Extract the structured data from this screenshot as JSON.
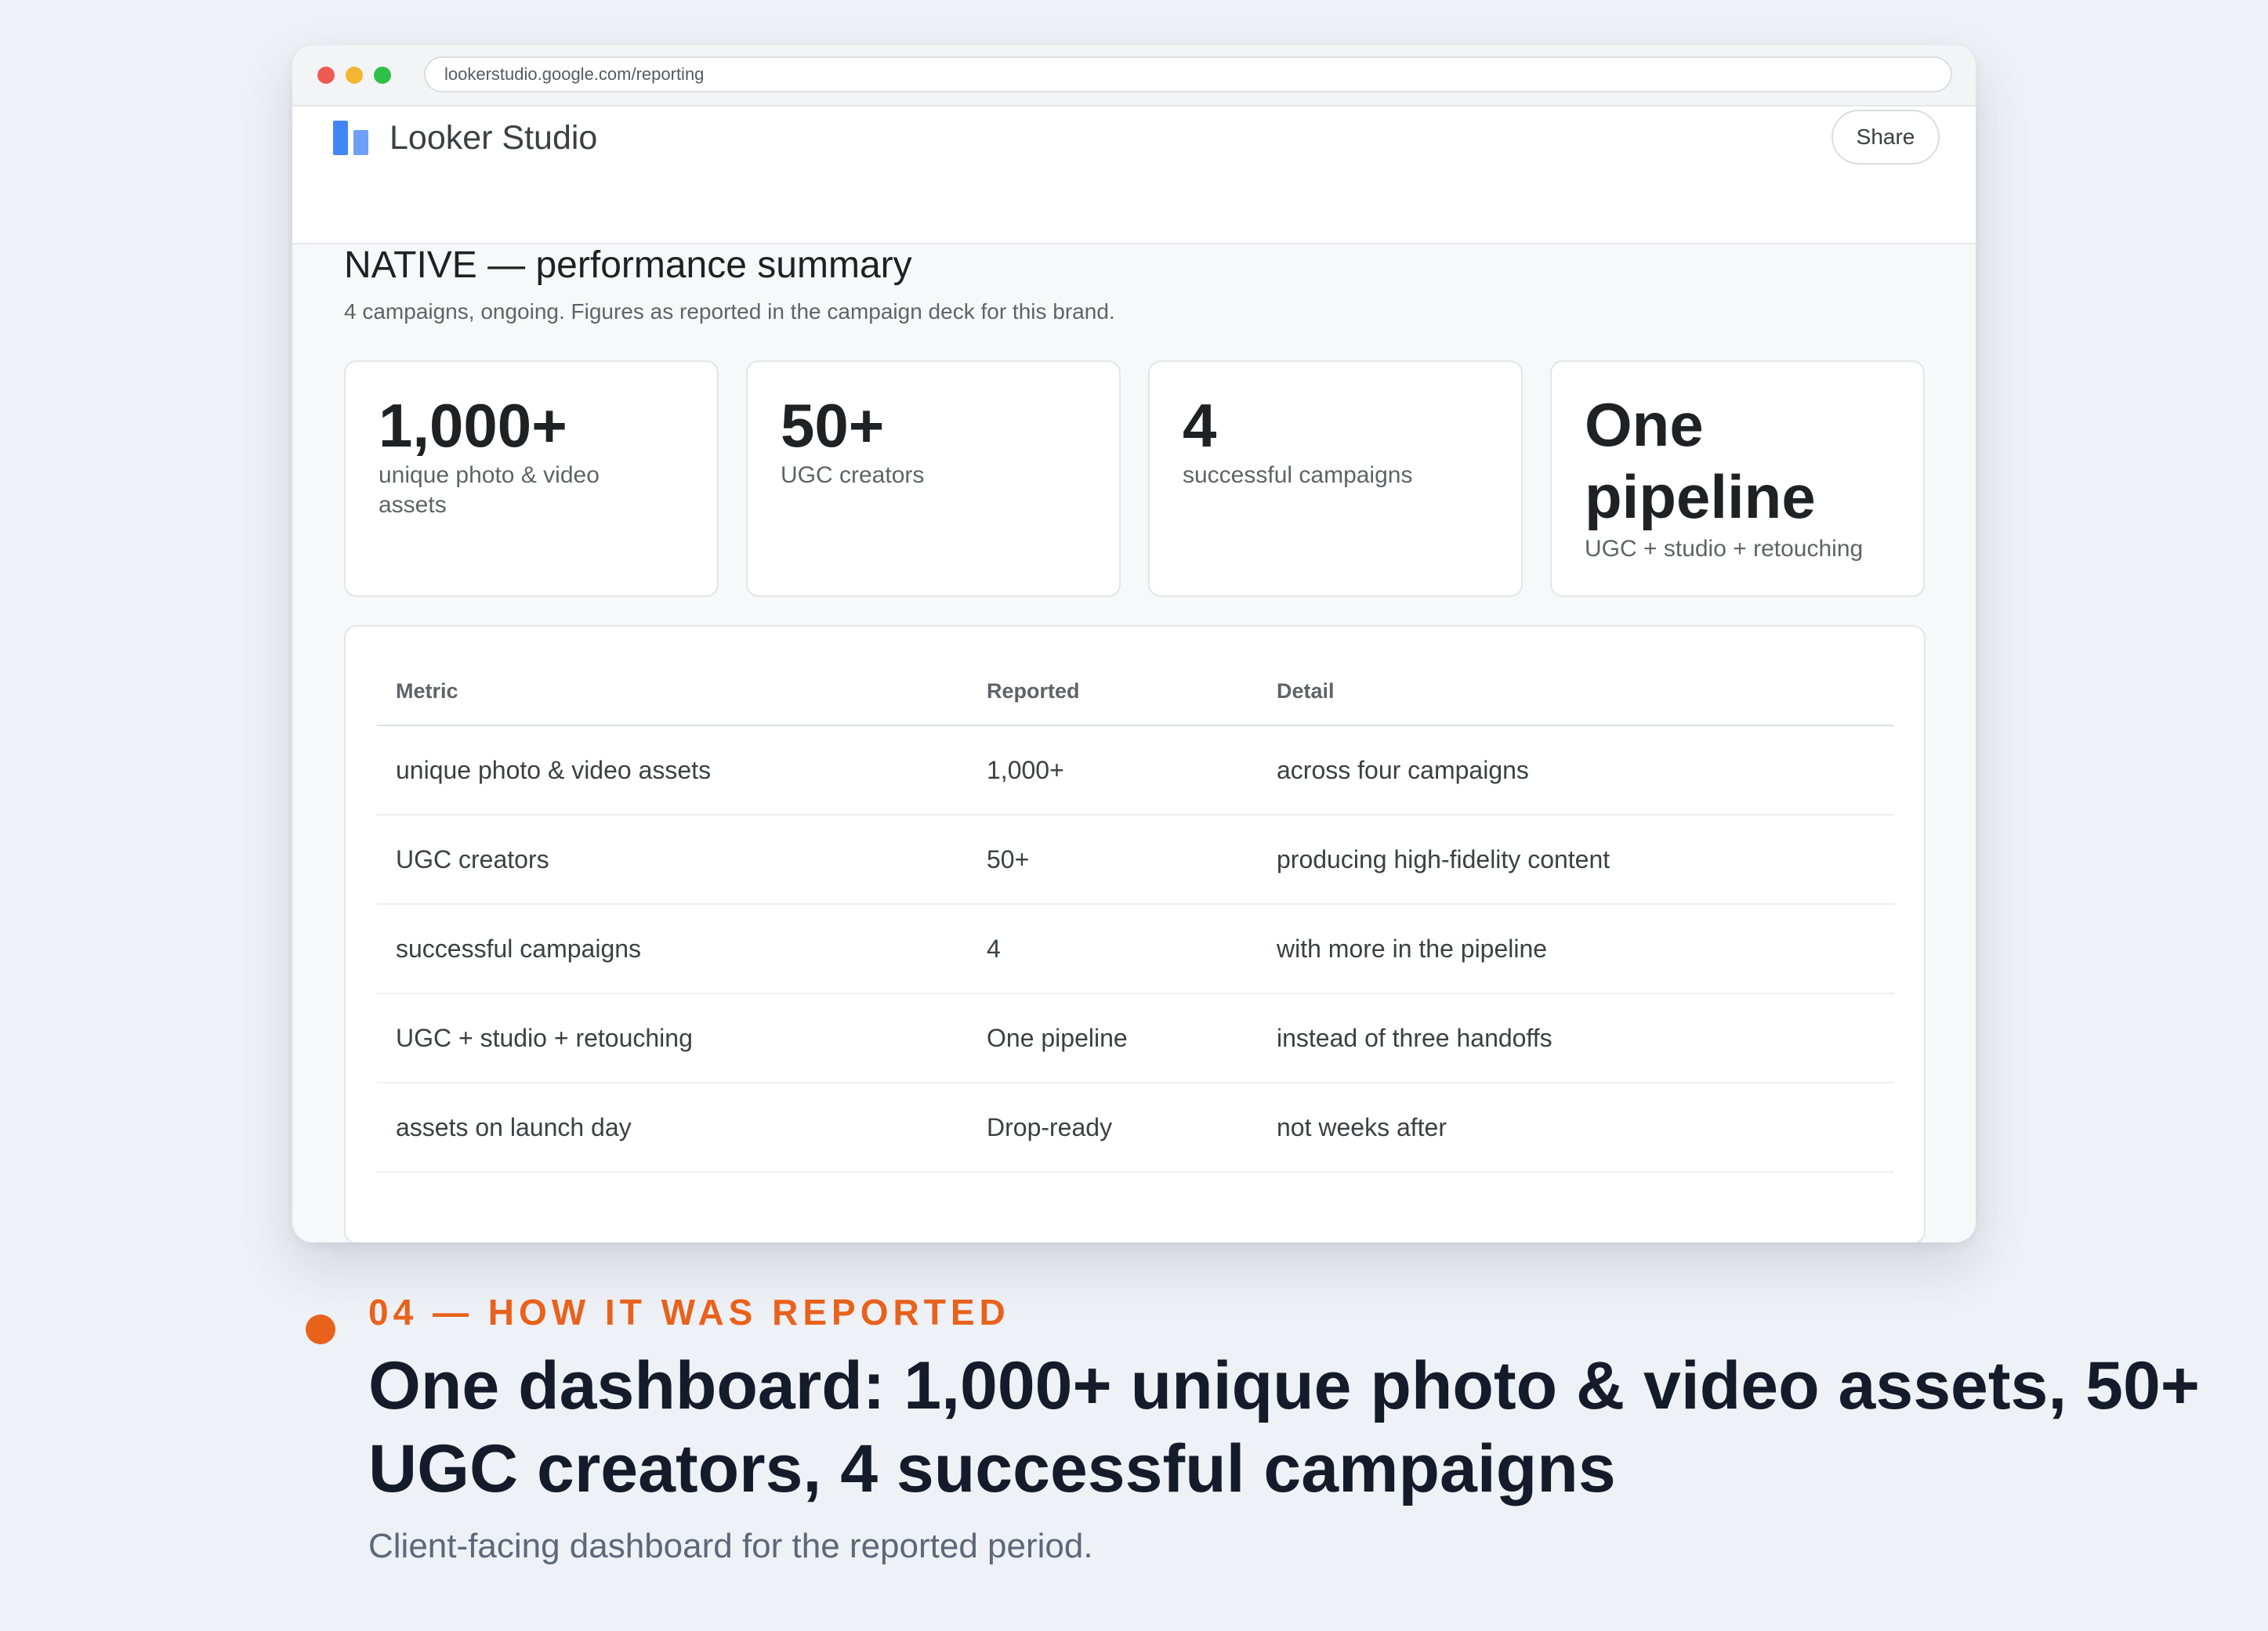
{
  "browser": {
    "url": "lookerstudio.google.com/reporting"
  },
  "app": {
    "name": "Looker Studio",
    "logo_icon": "looker-studio-logo",
    "share_label": "Share"
  },
  "report": {
    "title": "NATIVE — performance summary",
    "subtitle": "4 campaigns, ongoing. Figures as reported in the campaign deck for this brand."
  },
  "scorecards": [
    {
      "value": "1,000+",
      "label": "unique photo & video assets"
    },
    {
      "value": "50+",
      "label": "UGC creators"
    },
    {
      "value": "4",
      "label": "successful campaigns"
    },
    {
      "value": "One pipeline",
      "label": "UGC + studio + retouching"
    }
  ],
  "table": {
    "headers": [
      "Metric",
      "Reported",
      "Detail"
    ],
    "rows": [
      [
        "unique photo & video assets",
        "1,000+",
        "across four campaigns"
      ],
      [
        "UGC creators",
        "50+",
        "producing high-fidelity content"
      ],
      [
        "successful campaigns",
        "4",
        "with more in the pipeline"
      ],
      [
        "UGC + studio + retouching",
        "One pipeline",
        "instead of three handoffs"
      ],
      [
        "assets on launch day",
        "Drop-ready",
        "not weeks after"
      ]
    ]
  },
  "caption": {
    "eyebrow": "04 — HOW IT WAS REPORTED",
    "headline": "One dashboard: 1,000+ unique photo & video assets, 50+ UGC creators, 4 successful campaigns",
    "sub": "Client-facing dashboard for the reported period.",
    "accent_color": "#e8621c"
  }
}
